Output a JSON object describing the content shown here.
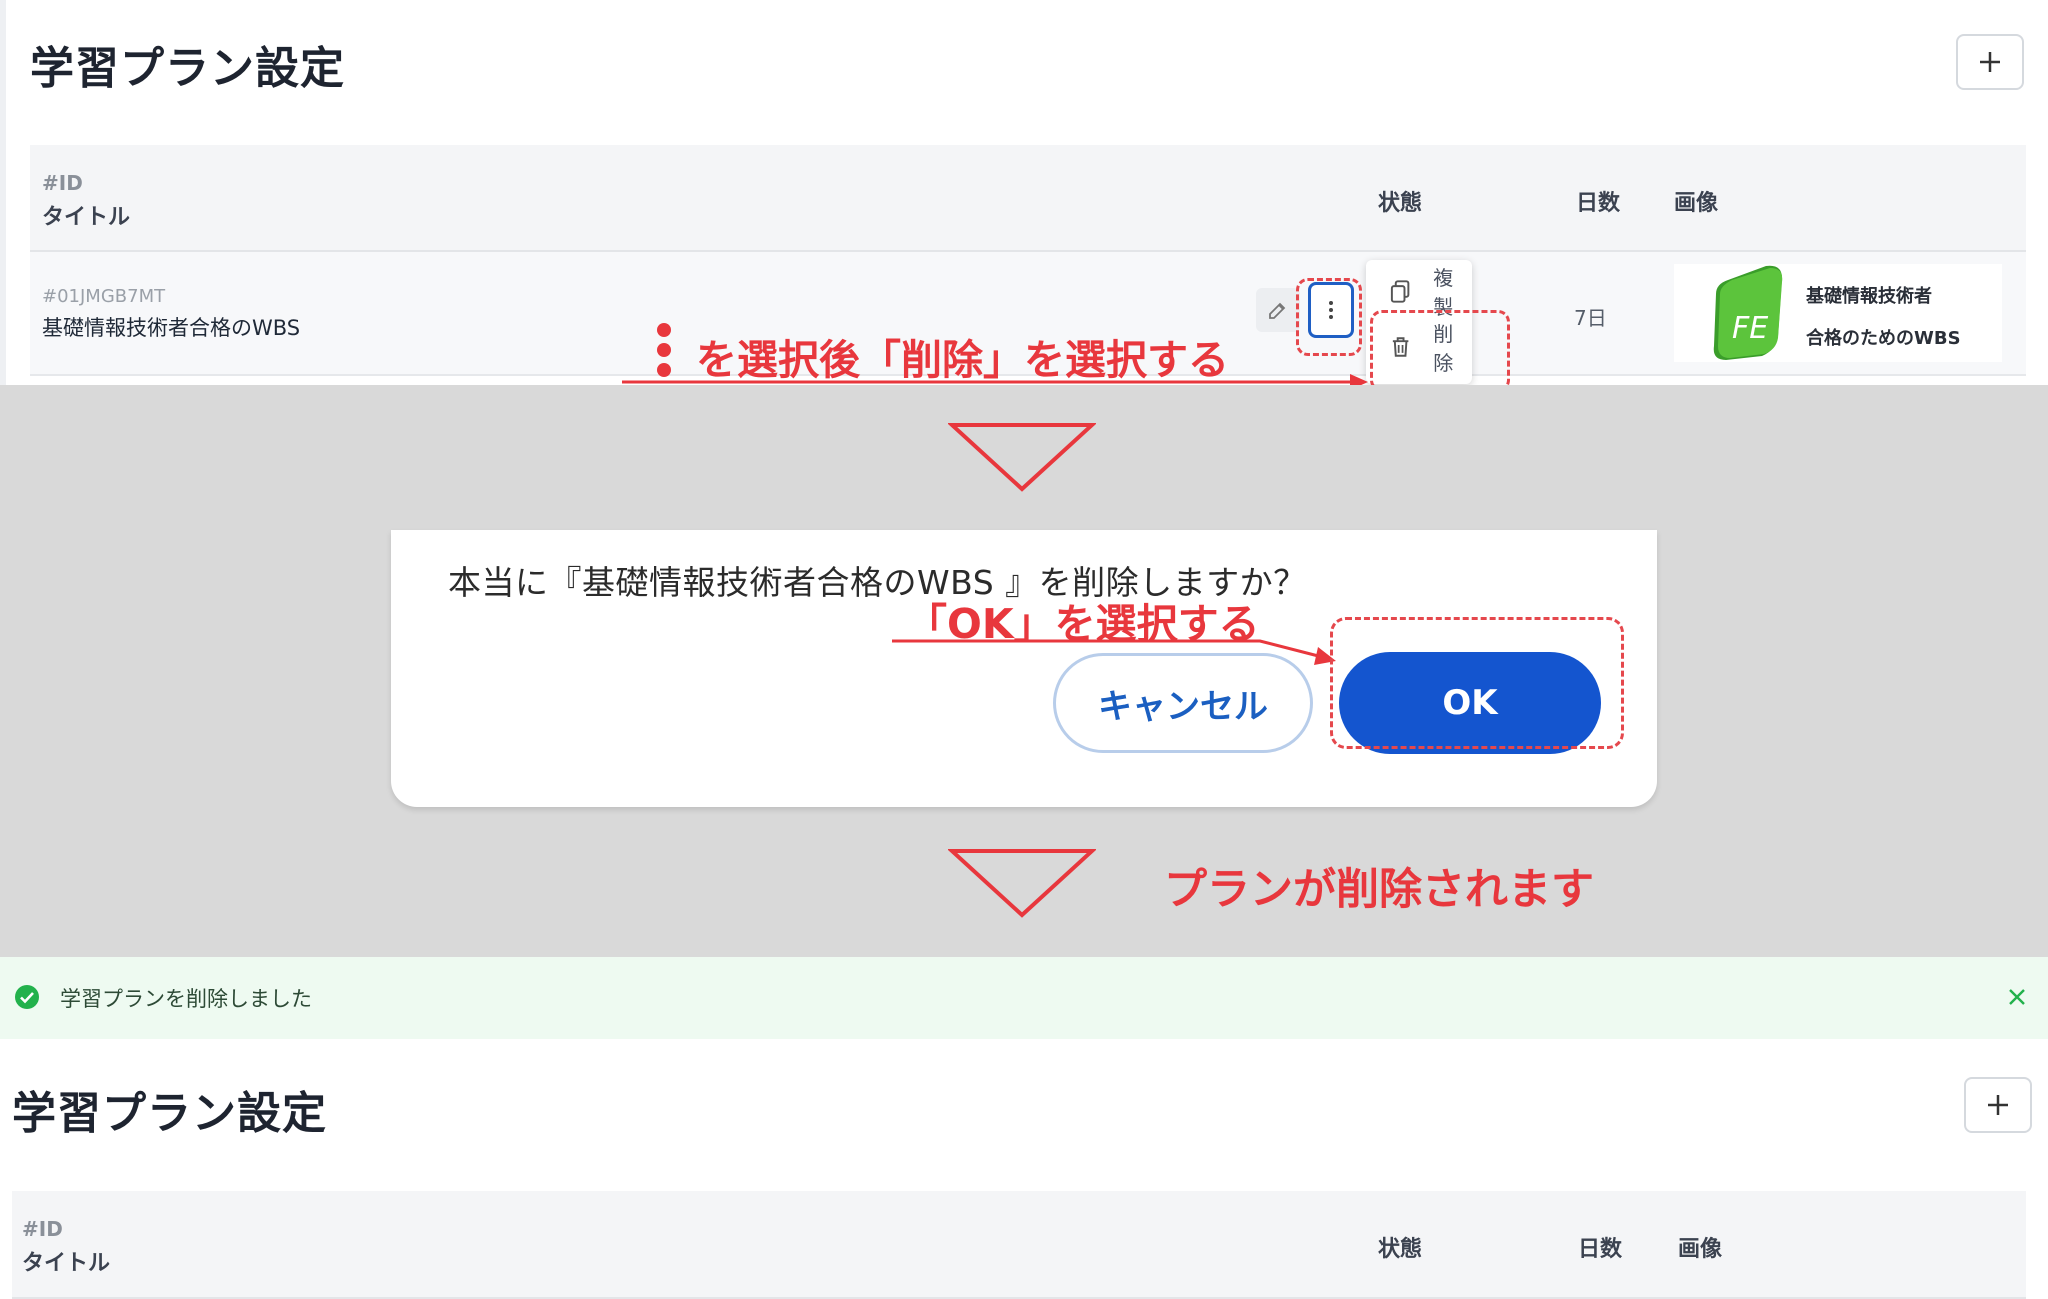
{
  "top": {
    "page_title": "学習プラン設定",
    "table": {
      "id_header": "#ID",
      "title_header": "タイトル",
      "status_header": "状態",
      "days_header": "日数",
      "image_header": "画像"
    },
    "row": {
      "id": "#01JMGB7MT",
      "title": "基礎情報技術者合格のWBS",
      "days": "7日",
      "thumbnail_line1": "基礎情報技術者",
      "thumbnail_line2": "合格のためのWBS",
      "thumbnail_logo": "FE"
    },
    "menu": {
      "copy_label": "複製",
      "delete_label": "削除"
    },
    "annotation": "を選択後「削除」を選択する"
  },
  "dialog": {
    "message": "本当に『基礎情報技術者合格のWBS 』を削除しますか？",
    "annotation": "「OK」を選択する",
    "cancel_label": "キャンセル",
    "ok_label": "OK"
  },
  "after_annotation": "プランが削除されます",
  "toast": {
    "message": "学習プランを削除しました"
  },
  "bottom": {
    "page_title": "学習プラン設定",
    "table": {
      "id_header": "#ID",
      "title_header": "タイトル",
      "status_header": "状態",
      "days_header": "日数",
      "image_header": "画像"
    }
  },
  "colors": {
    "annotation_red": "#e8373d",
    "primary_blue": "#1455cf",
    "success_green": "#22b14c",
    "overlay_gray": "#d9d9d9"
  },
  "icons": [
    "plus-icon",
    "edit-icon",
    "kebab-icon",
    "copy-icon",
    "trash-icon",
    "check-circle-icon",
    "close-icon",
    "down-arrow-icon"
  ]
}
